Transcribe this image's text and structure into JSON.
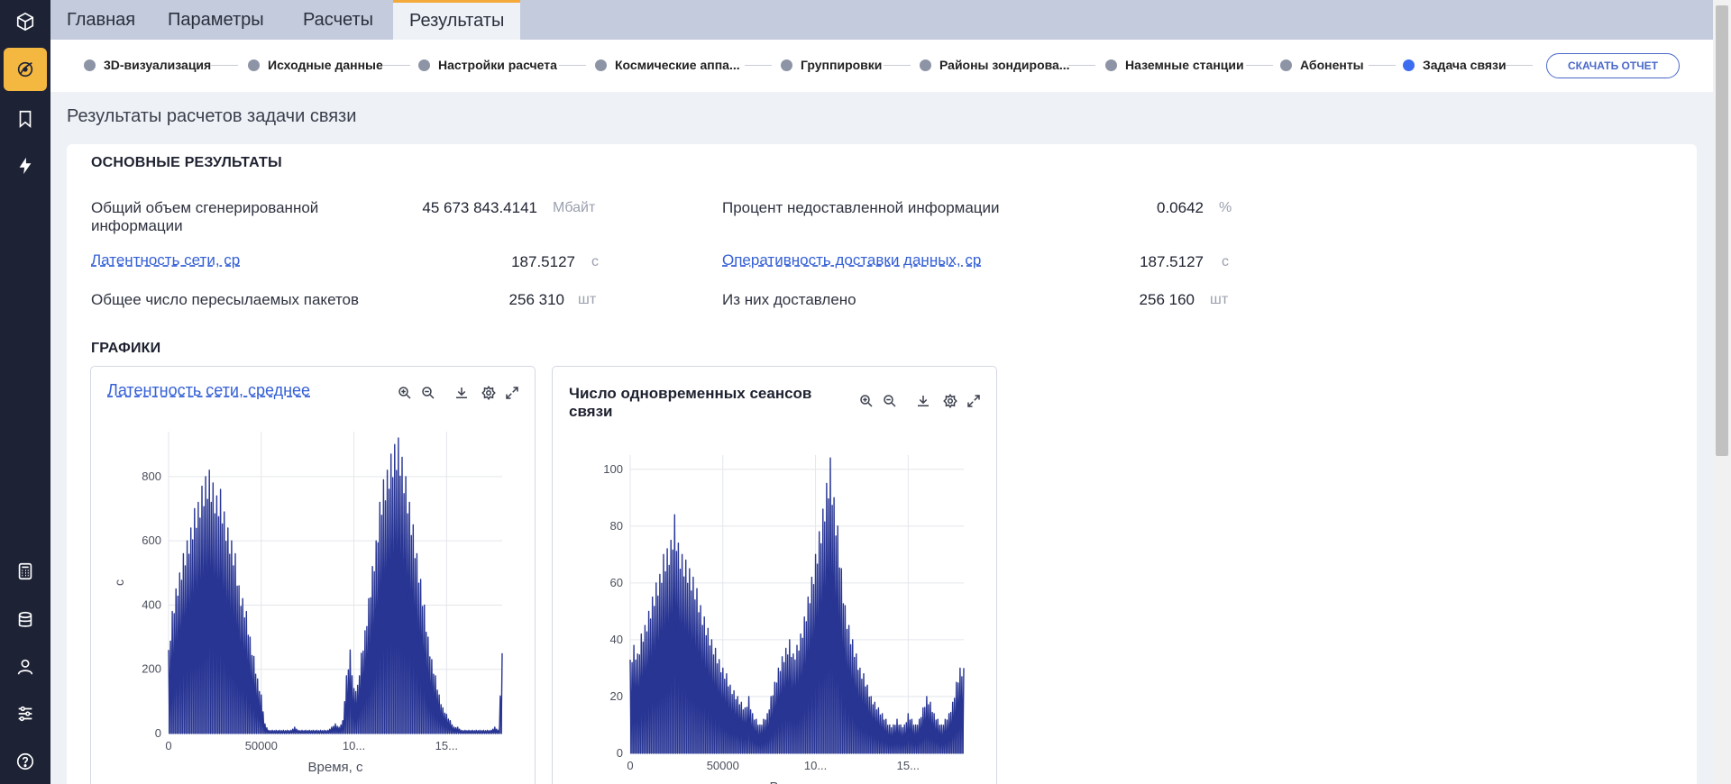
{
  "tabs": [
    "Главная",
    "Параметры",
    "Расчеты",
    "Результаты"
  ],
  "steps": [
    "3D-визуализация",
    "Исходные данные",
    "Настройки расчета",
    "Космические аппа...",
    "Группировки",
    "Районы зондирова...",
    "Наземные станции",
    "Абоненты",
    "Задача связи"
  ],
  "download_button": "СКАЧАТЬ ОТЧЕТ",
  "page_title": "Результаты расчетов задачи связи",
  "main_results": {
    "title": "ОСНОВНЫЕ РЕЗУЛЬТАТЫ",
    "generated_label_line1": "Общий объем сгенерированной",
    "generated_label_line2": "информации",
    "generated_value": "45 673 843.4141",
    "generated_unit": "Мбайт",
    "undelivered_label": "Процент недоставленной информации",
    "undelivered_value": "0.0642",
    "undelivered_unit": "%",
    "latency_label": "Латентность сети, ср",
    "latency_value": "187.5127",
    "latency_unit": "с",
    "speed_label": "Оперативность доставки данных, ср",
    "speed_value": "187.5127",
    "speed_unit": "с",
    "packets_label": "Общее число пересылаемых пакетов",
    "packets_value": "256 310",
    "packets_unit": "шт",
    "delivered_label": "Из них доставлено",
    "delivered_value": "256 160",
    "delivered_unit": "шт"
  },
  "charts_title": "ГРАФИКИ",
  "chart_data": [
    {
      "type": "line",
      "title": "Латентность сети, среднее",
      "xlabel": "Время, с",
      "ylabel": "с",
      "xlim": [
        0,
        180000
      ],
      "ylim": [
        0,
        940
      ],
      "x_ticks": [
        "0",
        "50000",
        "10...",
        "15..."
      ],
      "y_ticks": [
        0,
        200,
        400,
        600,
        800
      ],
      "color": "#283593",
      "series": [
        {
          "x": [
            0,
            2000,
            4000,
            6000,
            8000,
            10000,
            12000,
            14000,
            16000,
            18000,
            20000,
            22000,
            24000,
            26000,
            28000,
            30000,
            32000,
            34000,
            36000,
            38000,
            40000,
            42000,
            44000,
            46000,
            48000,
            50000,
            52000,
            54000,
            56000,
            58000,
            60000,
            62000,
            64000,
            66000,
            68000,
            70000,
            72000,
            74000,
            76000,
            78000,
            80000,
            82000,
            84000,
            86000,
            88000,
            90000,
            92000,
            94000,
            96000,
            98000,
            100000,
            102000,
            104000,
            106000,
            108000,
            110000,
            112000,
            114000,
            116000,
            118000,
            120000,
            122000,
            124000,
            126000,
            128000,
            130000,
            132000,
            134000,
            136000,
            138000,
            140000,
            142000,
            144000,
            146000,
            148000,
            150000,
            152000,
            154000,
            156000,
            158000,
            160000,
            162000,
            164000,
            166000,
            168000,
            170000,
            172000,
            174000,
            176000,
            178000,
            180000
          ],
          "y": [
            260,
            380,
            450,
            500,
            560,
            600,
            640,
            700,
            720,
            770,
            800,
            820,
            780,
            740,
            760,
            690,
            640,
            600,
            560,
            460,
            420,
            380,
            300,
            240,
            170,
            120,
            30,
            10,
            10,
            10,
            10,
            10,
            10,
            10,
            20,
            10,
            10,
            10,
            10,
            10,
            10,
            10,
            10,
            10,
            20,
            30,
            20,
            40,
            180,
            260,
            140,
            150,
            250,
            320,
            420,
            520,
            600,
            720,
            790,
            820,
            870,
            900,
            920,
            860,
            800,
            720,
            650,
            560,
            480,
            400,
            300,
            230,
            180,
            120,
            80,
            60,
            40,
            20,
            20,
            10,
            10,
            10,
            10,
            10,
            10,
            10,
            10,
            10,
            20,
            10,
            250
          ]
        }
      ]
    },
    {
      "type": "line",
      "title": "Число одновременных сеансов связи",
      "xlabel": "Время, с",
      "ylabel": "",
      "xlim": [
        0,
        180000
      ],
      "ylim": [
        0,
        105
      ],
      "x_ticks": [
        "0",
        "50000",
        "10...",
        "15..."
      ],
      "y_ticks": [
        0,
        20,
        40,
        60,
        80,
        100
      ],
      "color": "#283593",
      "series": [
        {
          "x": [
            0,
            2000,
            4000,
            6000,
            8000,
            10000,
            12000,
            14000,
            16000,
            18000,
            20000,
            22000,
            24000,
            26000,
            28000,
            30000,
            32000,
            34000,
            36000,
            38000,
            40000,
            42000,
            44000,
            46000,
            48000,
            50000,
            52000,
            54000,
            56000,
            58000,
            60000,
            62000,
            64000,
            66000,
            68000,
            70000,
            72000,
            74000,
            76000,
            78000,
            80000,
            82000,
            84000,
            86000,
            88000,
            90000,
            92000,
            94000,
            96000,
            98000,
            100000,
            102000,
            104000,
            106000,
            108000,
            110000,
            112000,
            114000,
            116000,
            118000,
            120000,
            122000,
            124000,
            126000,
            128000,
            130000,
            132000,
            134000,
            136000,
            138000,
            140000,
            142000,
            144000,
            146000,
            148000,
            150000,
            152000,
            154000,
            156000,
            158000,
            160000,
            162000,
            164000,
            166000,
            168000,
            170000,
            172000,
            174000,
            176000,
            178000,
            180000
          ],
          "y": [
            33,
            38,
            35,
            42,
            45,
            50,
            55,
            60,
            63,
            70,
            72,
            75,
            84,
            74,
            70,
            68,
            65,
            62,
            58,
            52,
            48,
            44,
            40,
            37,
            33,
            30,
            28,
            24,
            22,
            20,
            18,
            16,
            20,
            14,
            12,
            10,
            12,
            14,
            20,
            25,
            30,
            34,
            37,
            40,
            35,
            38,
            42,
            48,
            55,
            62,
            70,
            78,
            86,
            95,
            104,
            90,
            80,
            65,
            52,
            45,
            40,
            35,
            30,
            28,
            24,
            20,
            18,
            16,
            14,
            12,
            10,
            10,
            12,
            10,
            10,
            14,
            12,
            10,
            12,
            16,
            20,
            18,
            14,
            12,
            10,
            12,
            14,
            18,
            25,
            30,
            30
          ]
        }
      ]
    }
  ]
}
